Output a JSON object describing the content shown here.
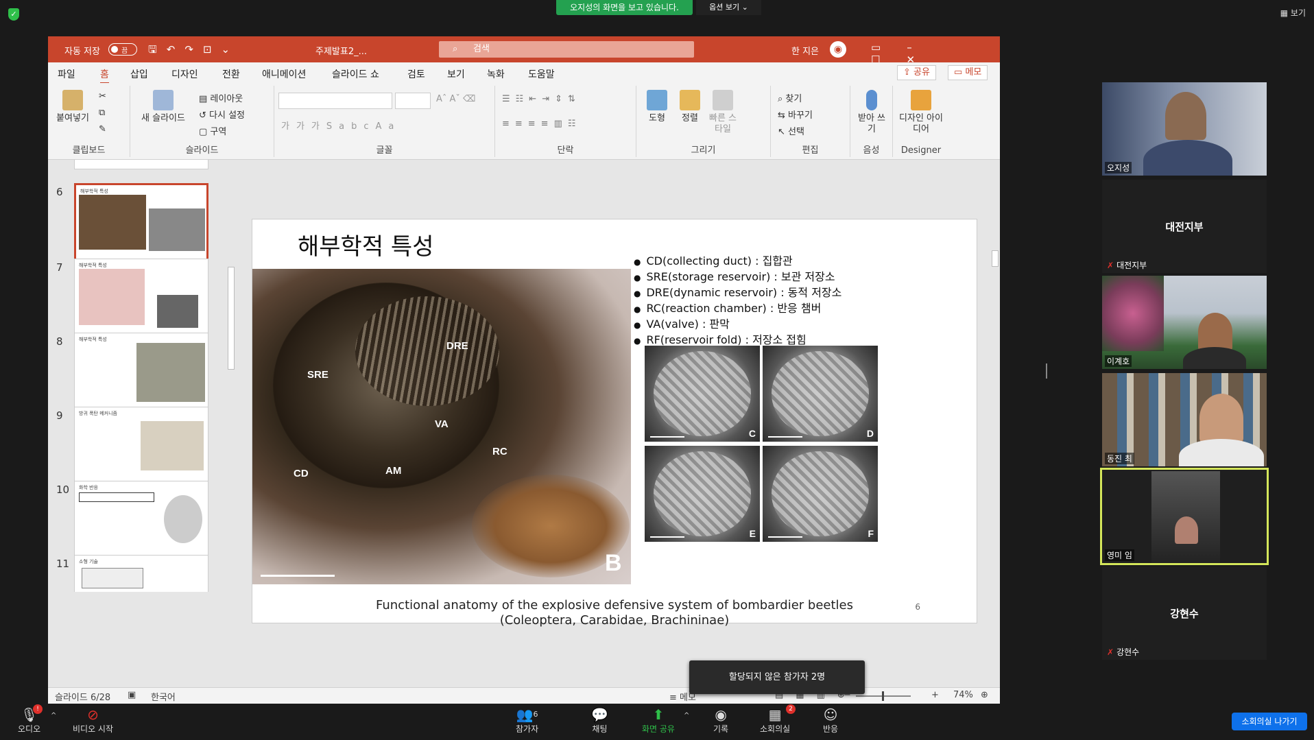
{
  "zoom": {
    "share_banner": "오지성의 화면을 보고 있습니다.",
    "view_options": "옵션 보기 ⌄",
    "view": "보기",
    "toolbar": [
      {
        "icon": "microphone-icon",
        "label": "오디오"
      },
      {
        "icon": "video-off-icon",
        "label": "비디오 시작"
      },
      {
        "icon": "participants-icon",
        "label": "참가자",
        "count": "6"
      },
      {
        "icon": "chat-icon",
        "label": "채팅"
      },
      {
        "icon": "share-screen-icon",
        "label": "화면 공유"
      },
      {
        "icon": "record-icon",
        "label": "기록"
      },
      {
        "icon": "breakout-rooms-icon",
        "label": "소회의실",
        "count": "2"
      },
      {
        "icon": "reaction-icon",
        "label": "반응"
      }
    ],
    "leave_breakout": "소회의실 나가기",
    "tooltip": "할당되지 않은 참가자 2명",
    "participants": [
      {
        "name": "오지성",
        "video": true
      },
      {
        "name": "대전지부",
        "video": false,
        "center_label": "대전지부",
        "muted": true
      },
      {
        "name": "이계호",
        "video": true
      },
      {
        "name": "동진 최",
        "video": true
      },
      {
        "name": "영미 임",
        "video": true,
        "highlighted": true
      },
      {
        "name": "강현수",
        "video": false,
        "center_label": "강현수",
        "muted": true
      }
    ],
    "accent": "#24a150",
    "leave_color": "#0e71eb"
  },
  "ppt": {
    "autosave": "자동 저장",
    "autosave_state": "끔",
    "filename": "주제발표2_...",
    "search_placeholder": "검색",
    "user": "한 지은",
    "menus": [
      "파일",
      "홈",
      "삽입",
      "디자인",
      "전환",
      "애니메이션",
      "슬라이드 쇼",
      "검토",
      "보기",
      "녹화",
      "도움말"
    ],
    "active_menu": "홈",
    "share": "공유",
    "memo": "메모",
    "ribbon": {
      "clipboard": {
        "label": "클립보드",
        "paste": "붙여넣기"
      },
      "slides": {
        "label": "슬라이드",
        "new_slide": "새 슬라이드",
        "layout": "레이아웃",
        "reset": "다시 설정",
        "section": "구역"
      },
      "font": {
        "label": "글꼴"
      },
      "paragraph": {
        "label": "단락"
      },
      "drawing": {
        "label": "그리기",
        "shape": "도형",
        "arrange": "정렬",
        "quick_style": "빠른 스타일"
      },
      "editing": {
        "label": "편집",
        "find": "찾기",
        "replace": "바꾸기",
        "select": "선택"
      },
      "voice": {
        "label": "음성",
        "dictate": "받아 쓰기"
      },
      "designer": {
        "label": "Designer",
        "ideas": "디자인 아이디어"
      }
    },
    "accent": "#c8452c",
    "thumbnails": [
      {
        "num": "6",
        "title": "해부학적 특성",
        "active": true
      },
      {
        "num": "7",
        "title": "해부학적 특성"
      },
      {
        "num": "8",
        "title": "해부학적 특성"
      },
      {
        "num": "9",
        "title": "방귀 폭탄 메커니즘"
      },
      {
        "num": "10",
        "title": "화학 반응"
      },
      {
        "num": "11",
        "title": "소형 기술"
      }
    ],
    "status": {
      "slide": "슬라이드 6/28",
      "language": "한국어",
      "notes": "메모",
      "zoom": "74%"
    },
    "slide": {
      "title": "해부학적 특성",
      "bullets": [
        "CD(collecting duct) : 집합관",
        "SRE(storage reservoir) : 보관 저장소",
        "DRE(dynamic reservoir) : 동적 저장소",
        "RC(reaction chamber) : 반응 챔버",
        "VA(valve) : 판막",
        "RF(reservoir fold) : 저장소 접힘"
      ],
      "photo_labels": {
        "dre": "DRE",
        "sre": "SRE",
        "va": "VA",
        "rc": "RC",
        "cd": "CD",
        "am": "AM",
        "panel": "B"
      },
      "sem_panels": [
        "C",
        "D",
        "E",
        "F"
      ],
      "caption_line1": "Functional anatomy of the explosive defensive system of bombardier beetles",
      "caption_line2": "(Coleoptera, Carabidae, Brachininae)",
      "page": "6"
    }
  }
}
